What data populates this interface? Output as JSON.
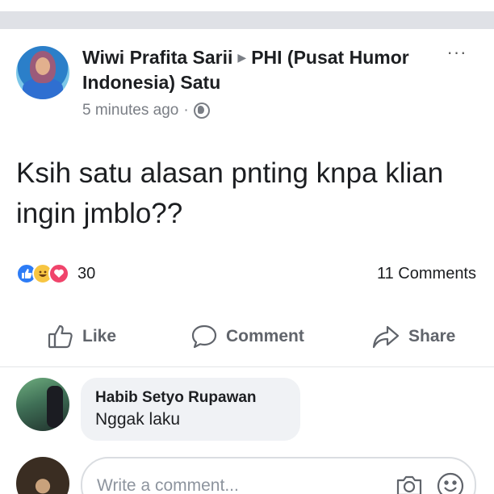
{
  "post": {
    "author": "Wiwi Prafita Sarii",
    "arrow": "▶",
    "group": "PHI (Pusat Humor Indonesia) Satu",
    "time": "5 minutes ago",
    "separator": "·",
    "privacy_icon": "globe-icon",
    "more_label": "···",
    "text": "Ksih satu alasan pnting knpa klian ingin jmblo??"
  },
  "stats": {
    "reaction_icons": [
      "like-icon",
      "haha-icon",
      "love-icon"
    ],
    "reaction_count": "30",
    "comments_label": "11 Comments"
  },
  "actions": {
    "like": "Like",
    "comment": "Comment",
    "share": "Share"
  },
  "comment": {
    "author": "Habib Setyo Rupawan",
    "text": "Nggak laku"
  },
  "composer": {
    "placeholder": "Write a comment..."
  },
  "colors": {
    "like_blue": "#2d7cf6",
    "love_red": "#f0446b",
    "haha_yellow": "#f7c542",
    "action_gray": "#60646b",
    "bubble_bg": "#f0f2f5",
    "section_gap": "#dfe1e6"
  }
}
